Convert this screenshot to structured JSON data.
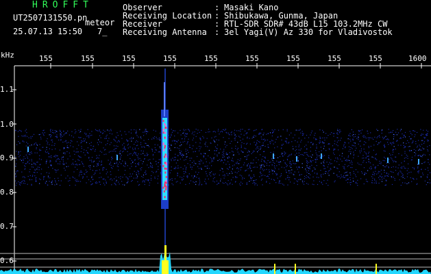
{
  "header": {
    "brand": "HROFFT",
    "filename": "UT2507131550.pn",
    "mode": "meteor",
    "datetime": "25.07.13 15:50",
    "counter": "7_",
    "fields": [
      {
        "key": "Observer",
        "value": "Masaki Kano"
      },
      {
        "key": "Receiving Location",
        "value": "Shibukawa, Gunma, Japan"
      },
      {
        "key": "Receiver",
        "value": "RTL-SDR SDR# 43dB L15 103.2MHz CW"
      },
      {
        "key": "Receiving Antenna",
        "value": "3el Yagi(V) Az 330 for Vladivostok"
      }
    ]
  },
  "axes": {
    "y_unit": "kHz",
    "y_ticks": [
      "1.1",
      "1.0",
      "0.9",
      "0.8",
      "0.7",
      "0.6"
    ],
    "x_ticks": [
      "155",
      "155",
      "155",
      "155",
      "155",
      "155",
      "155",
      "155",
      "155",
      "1600"
    ]
  },
  "colors": {
    "background": "#000000",
    "noise": "#1a2aa8",
    "signal_core": "#ff2a6a",
    "signal_mid": "#30e0ff",
    "signal_hot": "#ffff20",
    "power_trace": "#22d7ff",
    "header_green": "#32ff5a"
  }
}
